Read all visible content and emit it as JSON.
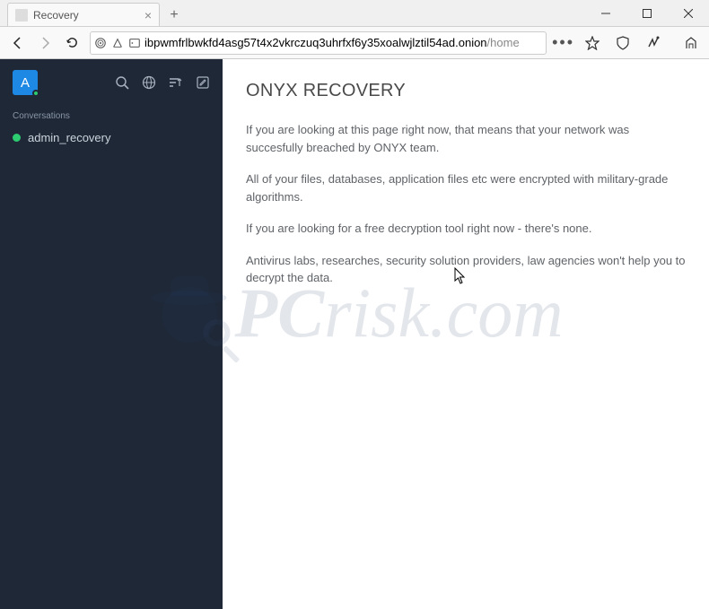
{
  "window": {
    "tab_title": "Recovery",
    "minimize": "–",
    "maximize": "☐",
    "close": "✕"
  },
  "toolbar": {
    "url_host": "ibpwmfrlbwkfd4asg57t4x2vkrczuq3uhrfxf6y35xoalwjlztil54ad.onion",
    "url_path": "/home",
    "menu_dots": "•••"
  },
  "sidebar": {
    "avatar_letter": "A",
    "section_label": "Conversations",
    "items": [
      {
        "label": "admin_recovery",
        "online": true
      }
    ]
  },
  "main": {
    "title": "ONYX RECOVERY",
    "para1": "If you are looking at this page right now, that means that your network was succesfully breached by ONYX team.",
    "para2": "All of your files, databases, application files etc were encrypted with military-grade algorithms.",
    "para3": "If you are looking for a free decryption tool right now - there's none.",
    "para4": "Antivirus labs, researches, security solution providers, law agencies won't help you to decrypt the data."
  },
  "watermark": {
    "prefix": "PC",
    "suffix": "risk.com"
  }
}
